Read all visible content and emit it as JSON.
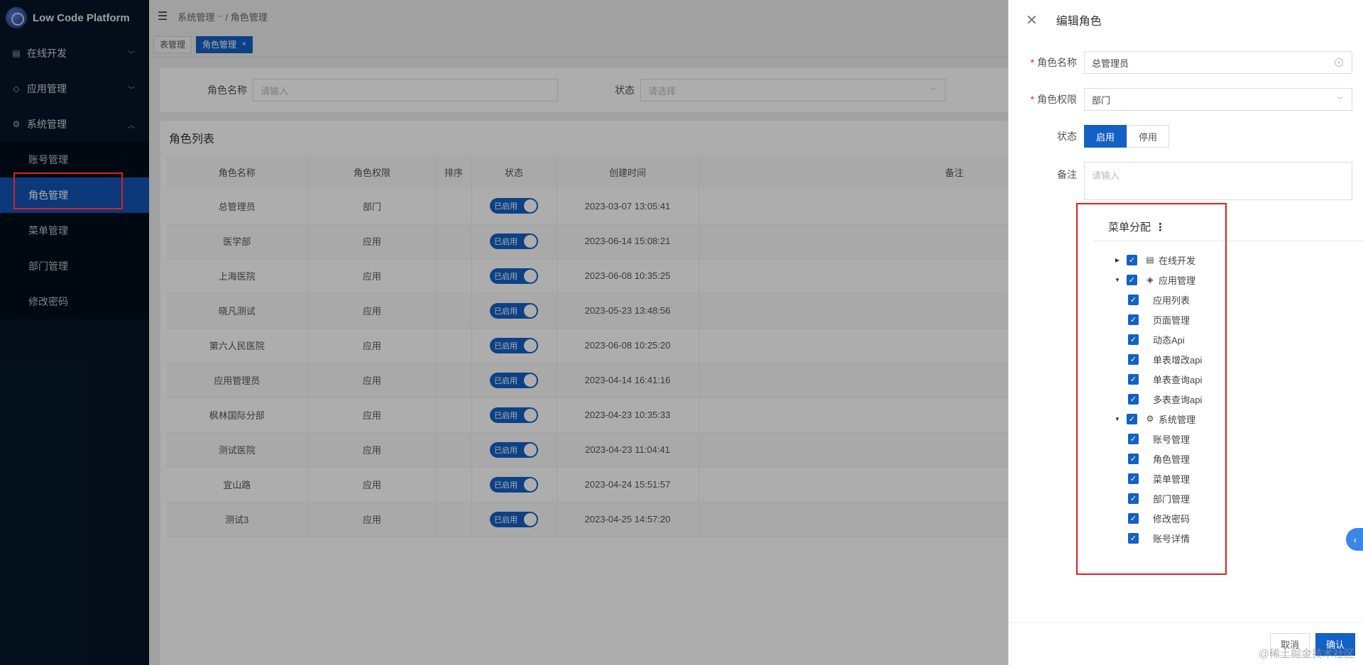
{
  "app": {
    "title": "Low Code Platform"
  },
  "sidebar": {
    "groups": [
      {
        "label": "在线开发",
        "icon": "document-icon",
        "expanded": false
      },
      {
        "label": "应用管理",
        "icon": "diamond-icon",
        "expanded": false
      },
      {
        "label": "系统管理",
        "icon": "gear-icon",
        "expanded": true
      }
    ],
    "sub_items": [
      {
        "label": "账号管理"
      },
      {
        "label": "角色管理",
        "active": true
      },
      {
        "label": "菜单管理"
      },
      {
        "label": "部门管理"
      },
      {
        "label": "修改密码"
      }
    ]
  },
  "breadcrumb": {
    "root": "系统管理",
    "sep": "/",
    "current": "角色管理"
  },
  "tabs": [
    {
      "label": "表管理"
    },
    {
      "label": "角色管理",
      "active": true,
      "close": "×"
    }
  ],
  "search": {
    "name_label": "角色名称",
    "name_placeholder": "请输入",
    "status_label": "状态",
    "status_placeholder": "请选择"
  },
  "role_list": {
    "title": "角色列表",
    "headers": [
      "角色名称",
      "角色权限",
      "排序",
      "状态",
      "创建时间",
      "备注"
    ],
    "switch_label": "已启用",
    "rows": [
      {
        "name": "总管理员",
        "perm": "部门",
        "time": "2023-03-07 13:05:41"
      },
      {
        "name": "医学部",
        "perm": "应用",
        "time": "2023-06-14 15:08:21"
      },
      {
        "name": "上海医院",
        "perm": "应用",
        "time": "2023-06-08 10:35:25"
      },
      {
        "name": "晓凡测试",
        "perm": "应用",
        "time": "2023-05-23 13:48:56"
      },
      {
        "name": "第六人民医院",
        "perm": "应用",
        "time": "2023-06-08 10:25:20"
      },
      {
        "name": "应用管理员",
        "perm": "应用",
        "time": "2023-04-14 16:41:16"
      },
      {
        "name": "枫林国际分部",
        "perm": "应用",
        "time": "2023-04-23 10:35:33"
      },
      {
        "name": "测试医院",
        "perm": "应用",
        "time": "2023-04-23 11:04:41"
      },
      {
        "name": "宜山路",
        "perm": "应用",
        "time": "2023-04-24 15:51:57"
      },
      {
        "name": "测试3",
        "perm": "应用",
        "time": "2023-04-25 14:57:20"
      }
    ]
  },
  "drawer": {
    "title": "编辑角色",
    "role_name_label": "角色名称",
    "role_name_value": "总管理员",
    "perm_label": "角色权限",
    "perm_value": "部门",
    "status_label": "状态",
    "status_on": "启用",
    "status_off": "停用",
    "note_label": "备注",
    "note_placeholder": "请输入",
    "menu_title": "菜单分配",
    "tree": [
      {
        "label": "在线开发",
        "level": 0,
        "caret": "right",
        "icon": "document-icon",
        "checked": true
      },
      {
        "label": "应用管理",
        "level": 0,
        "caret": "down",
        "icon": "diamond-icon",
        "checked": true
      },
      {
        "label": "应用列表",
        "level": 1,
        "checked": true
      },
      {
        "label": "页面管理",
        "level": 1,
        "checked": true
      },
      {
        "label": "动态Api",
        "level": 1,
        "checked": true
      },
      {
        "label": "单表增改api",
        "level": 1,
        "checked": true
      },
      {
        "label": "单表查询api",
        "level": 1,
        "checked": true
      },
      {
        "label": "多表查询api",
        "level": 1,
        "checked": true
      },
      {
        "label": "系统管理",
        "level": 0,
        "caret": "down",
        "icon": "gear-icon",
        "checked": true
      },
      {
        "label": "账号管理",
        "level": 1,
        "checked": true
      },
      {
        "label": "角色管理",
        "level": 1,
        "checked": true
      },
      {
        "label": "菜单管理",
        "level": 1,
        "checked": true
      },
      {
        "label": "部门管理",
        "level": 1,
        "checked": true
      },
      {
        "label": "修改密码",
        "level": 1,
        "checked": true
      },
      {
        "label": "账号详情",
        "level": 1,
        "checked": true
      }
    ],
    "cancel": "取消",
    "confirm": "确认"
  },
  "watermark": "@稀土掘金技术社区",
  "colors": {
    "primary": "#1361c4",
    "sidebar_bg": "#061629",
    "highlight": "#e02020"
  }
}
